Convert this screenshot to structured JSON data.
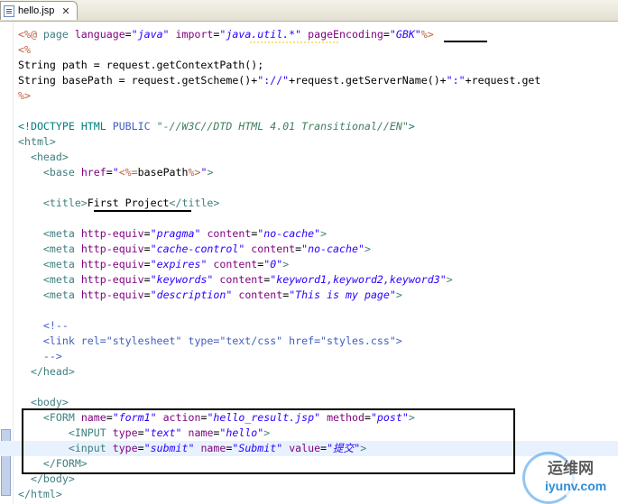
{
  "tab": {
    "title": "hello.jsp",
    "close": "✕",
    "icon": "jsp-file-icon"
  },
  "code_lines": [
    [
      [
        "d",
        "<%@ "
      ],
      [
        "t",
        "page "
      ],
      [
        "a",
        "language"
      ],
      [
        "p",
        "="
      ],
      [
        "v",
        "\"java\""
      ],
      [
        "p",
        " "
      ],
      [
        "a",
        "import"
      ],
      [
        "p",
        "="
      ],
      [
        "v",
        "\"java.util.*\""
      ],
      [
        "p",
        " "
      ],
      [
        "a",
        "pageEncoding"
      ],
      [
        "p",
        "="
      ],
      [
        "v",
        "\"GBK\""
      ],
      [
        "d",
        "%>"
      ]
    ],
    [
      [
        "d",
        "<%"
      ]
    ],
    [
      [
        "p",
        "String path = request.getContextPath();"
      ]
    ],
    [
      [
        "p",
        "String basePath = request.getScheme()+"
      ],
      [
        "s",
        "\"://\""
      ],
      [
        "p",
        "+request.getServerName()+"
      ],
      [
        "s",
        "\":\""
      ],
      [
        "p",
        "+request.get"
      ]
    ],
    [
      [
        "d",
        "%>"
      ]
    ],
    [],
    [
      [
        "x",
        "<!DOCTYPE "
      ],
      [
        "x",
        "HTML "
      ],
      [
        "c",
        "PUBLIC "
      ],
      [
        "y",
        "\"-//W3C//DTD HTML 4.01 Transitional//EN\""
      ],
      [
        "x",
        ">"
      ]
    ],
    [
      [
        "t",
        "<html>"
      ]
    ],
    [
      [
        "p",
        "  "
      ],
      [
        "t",
        "<head>"
      ]
    ],
    [
      [
        "p",
        "    "
      ],
      [
        "t",
        "<base "
      ],
      [
        "a",
        "href"
      ],
      [
        "p",
        "="
      ],
      [
        "v",
        "\""
      ],
      [
        "d",
        "<%="
      ],
      [
        "p",
        "basePath"
      ],
      [
        "d",
        "%>"
      ],
      [
        "v",
        "\""
      ],
      [
        "t",
        ">"
      ]
    ],
    [],
    [
      [
        "p",
        "    "
      ],
      [
        "t",
        "<title>"
      ],
      [
        "p",
        "First Project"
      ],
      [
        "t",
        "</title>"
      ]
    ],
    [],
    [
      [
        "p",
        "    "
      ],
      [
        "t",
        "<meta "
      ],
      [
        "a",
        "http-equiv"
      ],
      [
        "p",
        "="
      ],
      [
        "v",
        "\"pragma\""
      ],
      [
        "p",
        " "
      ],
      [
        "a",
        "content"
      ],
      [
        "p",
        "="
      ],
      [
        "v",
        "\"no-cache\""
      ],
      [
        "t",
        ">"
      ]
    ],
    [
      [
        "p",
        "    "
      ],
      [
        "t",
        "<meta "
      ],
      [
        "a",
        "http-equiv"
      ],
      [
        "p",
        "="
      ],
      [
        "v",
        "\"cache-control\""
      ],
      [
        "p",
        " "
      ],
      [
        "a",
        "content"
      ],
      [
        "p",
        "="
      ],
      [
        "v",
        "\"no-cache\""
      ],
      [
        "t",
        ">"
      ]
    ],
    [
      [
        "p",
        "    "
      ],
      [
        "t",
        "<meta "
      ],
      [
        "a",
        "http-equiv"
      ],
      [
        "p",
        "="
      ],
      [
        "v",
        "\"expires\""
      ],
      [
        "p",
        " "
      ],
      [
        "a",
        "content"
      ],
      [
        "p",
        "="
      ],
      [
        "v",
        "\"0\""
      ],
      [
        "t",
        ">"
      ]
    ],
    [
      [
        "p",
        "    "
      ],
      [
        "t",
        "<meta "
      ],
      [
        "a",
        "http-equiv"
      ],
      [
        "p",
        "="
      ],
      [
        "v",
        "\"keywords\""
      ],
      [
        "p",
        " "
      ],
      [
        "a",
        "content"
      ],
      [
        "p",
        "="
      ],
      [
        "v",
        "\"keyword1,keyword2,keyword3\""
      ],
      [
        "t",
        ">"
      ]
    ],
    [
      [
        "p",
        "    "
      ],
      [
        "t",
        "<meta "
      ],
      [
        "a",
        "http-equiv"
      ],
      [
        "p",
        "="
      ],
      [
        "v",
        "\"description\""
      ],
      [
        "p",
        " "
      ],
      [
        "a",
        "content"
      ],
      [
        "p",
        "="
      ],
      [
        "v",
        "\"This is my page\""
      ],
      [
        "t",
        ">"
      ]
    ],
    [],
    [
      [
        "p",
        "    "
      ],
      [
        "c",
        "<!--"
      ]
    ],
    [
      [
        "p",
        "    "
      ],
      [
        "c",
        "<link rel=\"stylesheet\" type=\"text/css\" href=\"styles.css\">"
      ]
    ],
    [
      [
        "p",
        "    "
      ],
      [
        "c",
        "-->"
      ]
    ],
    [
      [
        "p",
        "  "
      ],
      [
        "t",
        "</head>"
      ]
    ],
    [],
    [
      [
        "p",
        "  "
      ],
      [
        "t",
        "<body>"
      ]
    ],
    [
      [
        "p",
        "    "
      ],
      [
        "t",
        "<FORM "
      ],
      [
        "a",
        "name"
      ],
      [
        "p",
        "="
      ],
      [
        "v",
        "\"form1\""
      ],
      [
        "p",
        " "
      ],
      [
        "a",
        "action"
      ],
      [
        "p",
        "="
      ],
      [
        "v",
        "\"hello_result.jsp\""
      ],
      [
        "p",
        " "
      ],
      [
        "a",
        "method"
      ],
      [
        "p",
        "="
      ],
      [
        "v",
        "\"post\""
      ],
      [
        "t",
        ">"
      ]
    ],
    [
      [
        "p",
        "        "
      ],
      [
        "t",
        "<INPUT "
      ],
      [
        "a",
        "type"
      ],
      [
        "p",
        "="
      ],
      [
        "v",
        "\"text\""
      ],
      [
        "p",
        " "
      ],
      [
        "a",
        "name"
      ],
      [
        "p",
        "="
      ],
      [
        "v",
        "\"hello\""
      ],
      [
        "t",
        ">"
      ]
    ],
    [
      [
        "p",
        "        "
      ],
      [
        "t",
        "<input "
      ],
      [
        "a",
        "type"
      ],
      [
        "p",
        "="
      ],
      [
        "v",
        "\"submit\""
      ],
      [
        "p",
        " "
      ],
      [
        "a",
        "name"
      ],
      [
        "p",
        "="
      ],
      [
        "v",
        "\"Submit\""
      ],
      [
        "p",
        " "
      ],
      [
        "a",
        "value"
      ],
      [
        "p",
        "="
      ],
      [
        "v",
        "\"提交\""
      ],
      [
        "t",
        ">"
      ]
    ],
    [
      [
        "p",
        "    "
      ],
      [
        "t",
        "</FORM>"
      ]
    ],
    [
      [
        "p",
        "  "
      ],
      [
        "t",
        "</body>"
      ]
    ],
    [
      [
        "t",
        "</html>"
      ]
    ]
  ],
  "current_line_index": 27,
  "watermark": {
    "cn": "运维网",
    "url": "iyunv.com"
  },
  "colors": {
    "directive": "#bf5f3f",
    "tag": "#3f7f7f",
    "attribute": "#7f007f",
    "value": "#2a00ff",
    "comment": "#3f5fbf",
    "current_line": "#e8f2fe"
  }
}
